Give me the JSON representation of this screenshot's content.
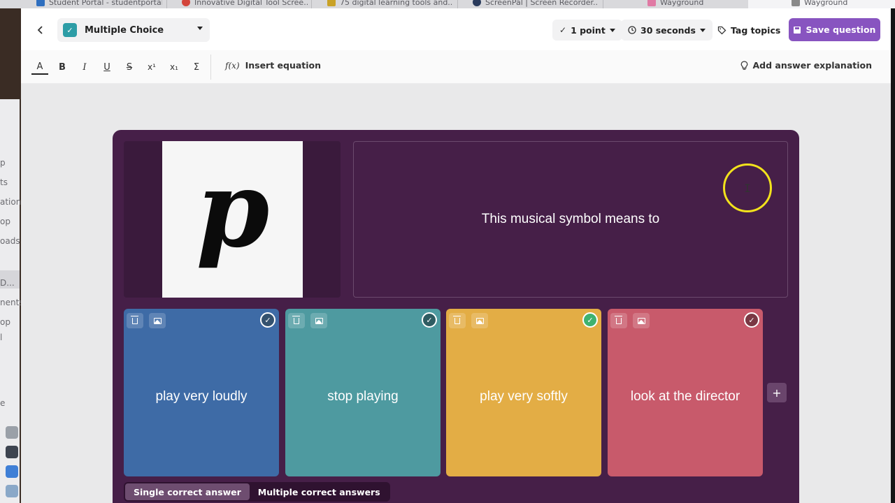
{
  "browser_tabs": [
    {
      "title": "Student Portal - studentportal",
      "favicon_color": "#2f6fbf"
    },
    {
      "title": "Innovative Digital Tool Scree...",
      "favicon_color": "#d3453b"
    },
    {
      "title": "75 digital learning tools and...",
      "favicon_color": "#c9a227"
    },
    {
      "title": "ScreenPal | Screen Recorder...",
      "favicon_color": "#2a3b5c"
    },
    {
      "title": "Wayground",
      "favicon_color": "#e07aa4"
    },
    {
      "title": "Wayground",
      "favicon_color": "#8a8a8a"
    }
  ],
  "left_window_fragments": [
    "p",
    "ts",
    "ation",
    "op",
    "oads",
    "D...",
    "nents",
    "op",
    "l",
    "e"
  ],
  "topbar": {
    "back_icon": "chevron-left-icon",
    "question_type": {
      "label": "Multiple Choice",
      "icon": "checkbox-icon"
    },
    "points": {
      "label": "1 point",
      "icon": "check-icon"
    },
    "time": {
      "label": "30 seconds",
      "icon": "clock-icon"
    },
    "tag_topics": {
      "label": "Tag topics",
      "icon": "tag-icon"
    },
    "save": {
      "label": "Save question",
      "icon": "save-icon"
    }
  },
  "toolbar": {
    "format_buttons": [
      {
        "glyph": "A",
        "name": "text-color-button"
      },
      {
        "glyph": "B",
        "name": "bold-button"
      },
      {
        "glyph": "I",
        "name": "italic-button"
      },
      {
        "glyph": "U",
        "name": "underline-button"
      },
      {
        "glyph": "S",
        "name": "strikethrough-button"
      },
      {
        "glyph": "x¹",
        "name": "superscript-button"
      },
      {
        "glyph": "x₁",
        "name": "subscript-button"
      },
      {
        "glyph": "Σ",
        "name": "symbols-button"
      }
    ],
    "insert_equation": {
      "icon_text": "f(x)",
      "label": "Insert equation"
    },
    "answer_explanation": {
      "label": "Add answer explanation",
      "icon": "lightbulb-icon"
    }
  },
  "question": {
    "media_glyph": "p",
    "text": "This musical symbol means to"
  },
  "options": [
    {
      "text": "play very loudly",
      "color": "#3e6ba6",
      "correct": false
    },
    {
      "text": "stop playing",
      "color": "#4e9aa0",
      "correct": false
    },
    {
      "text": "play very softly",
      "color": "#e3ad45",
      "correct": true
    },
    {
      "text": "look at the director",
      "color": "#c85a6b",
      "correct": false
    }
  ],
  "add_option_icon": "plus-icon",
  "answer_mode": {
    "single": "Single correct answer",
    "multiple": "Multiple correct answers",
    "selected": "single"
  },
  "colors": {
    "accent": "#8854c0",
    "card_bg": "#461f48",
    "correct_check": "#3fb26f"
  }
}
